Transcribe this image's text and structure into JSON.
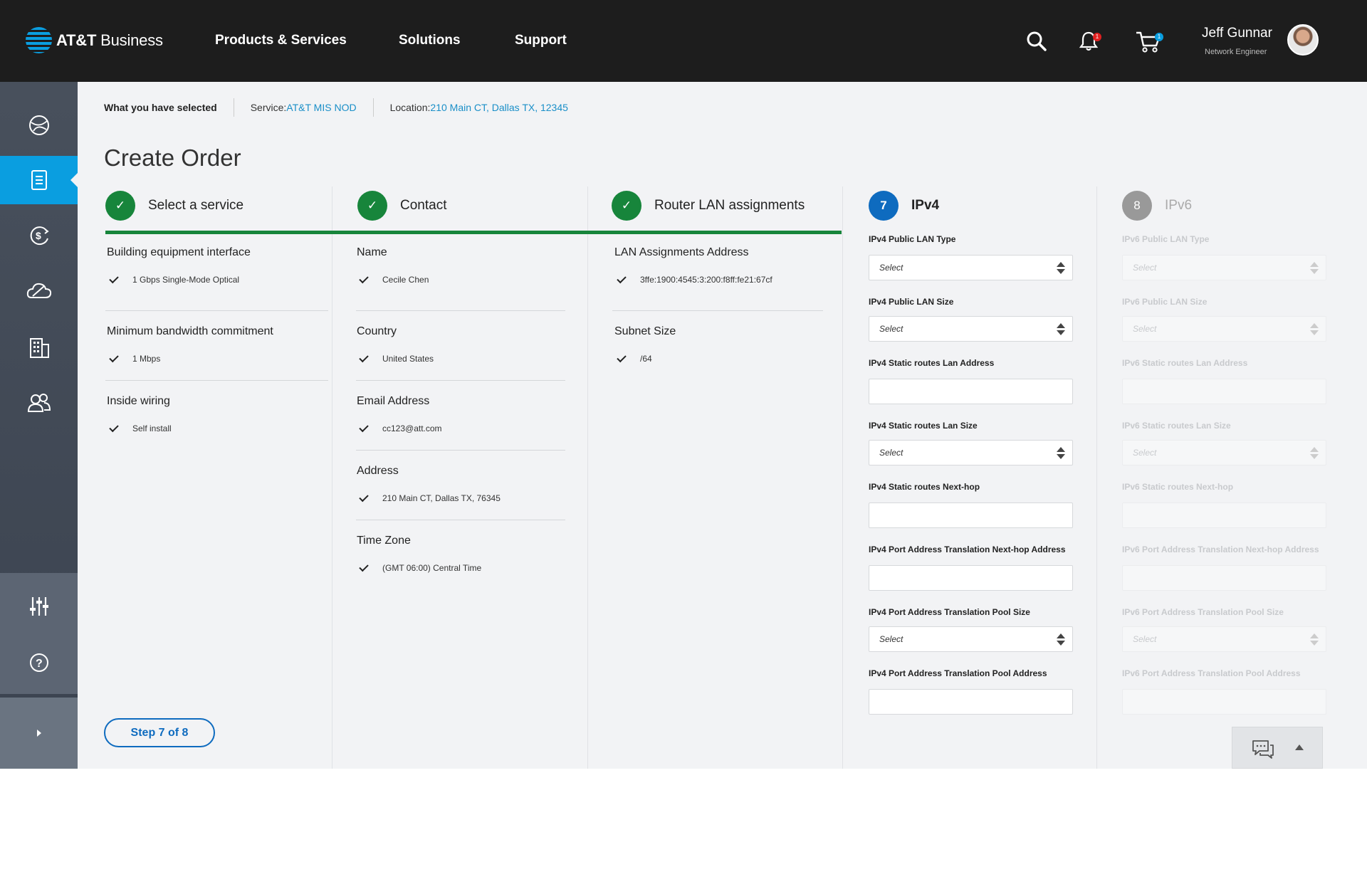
{
  "brand": {
    "name_bold": "AT&T",
    "name_rest": " Business"
  },
  "nav": {
    "items": [
      "Products & Services",
      "Solutions",
      "Support"
    ]
  },
  "header": {
    "notification_count": "1",
    "cart_count": "1"
  },
  "user": {
    "name": "Jeff Gunnar",
    "role": "Network Engineer"
  },
  "breadcrumb": {
    "title": "What you have selected",
    "service_label": "Service: ",
    "service_value": "AT&T MIS NOD",
    "location_label": "Location: ",
    "location_value": "210 Main CT, Dallas TX, 12345"
  },
  "page": {
    "title": "Create Order"
  },
  "steps": [
    {
      "label": "Select a service",
      "status": "done"
    },
    {
      "label": "Contact",
      "status": "done"
    },
    {
      "label": "Router LAN assignments",
      "status": "done"
    },
    {
      "number": "7",
      "label": "IPv4",
      "status": "current"
    },
    {
      "number": "8",
      "label": "IPv6",
      "status": "future"
    }
  ],
  "service": [
    {
      "label": "Building equipment interface",
      "value": "1 Gbps Single-Mode Optical"
    },
    {
      "label": "Minimum bandwidth commitment",
      "value": "1 Mbps"
    },
    {
      "label": "Inside wiring",
      "value": "Self install"
    }
  ],
  "contact": [
    {
      "label": "Name",
      "value": "Cecile Chen"
    },
    {
      "label": "Country",
      "value": "United States"
    },
    {
      "label": "Email Address",
      "value": "cc123@att.com"
    },
    {
      "label": "Address",
      "value": "210 Main CT, Dallas TX, 76345"
    },
    {
      "label": "Time Zone",
      "value": "(GMT 06:00) Central Time"
    }
  ],
  "router": [
    {
      "label": "LAN Assignments Address",
      "value": "3ffe:1900:4545:3:200:f8ff:fe21:67cf"
    },
    {
      "label": "Subnet Size",
      "value": "/64"
    }
  ],
  "ipv4": [
    {
      "label": "IPv4 Public LAN Type",
      "type": "select",
      "value": "Select"
    },
    {
      "label": "IPv4 Public LAN Size",
      "type": "select",
      "value": "Select"
    },
    {
      "label": "IPv4 Static routes Lan Address",
      "type": "text",
      "value": ""
    },
    {
      "label": "IPv4 Static routes Lan Size",
      "type": "select",
      "value": "Select"
    },
    {
      "label": "IPv4 Static routes Next-hop",
      "type": "text",
      "value": ""
    },
    {
      "label": "IPv4 Port Address Translation Next-hop Address",
      "type": "text",
      "value": ""
    },
    {
      "label": "IPv4 Port Address Translation Pool Size",
      "type": "select",
      "value": "Select"
    },
    {
      "label": "IPv4 Port Address Translation Pool Address",
      "type": "text",
      "value": ""
    }
  ],
  "ipv6": [
    {
      "label": "IPv6 Public LAN Type",
      "type": "select",
      "value": "Select"
    },
    {
      "label": "IPv6 Public LAN Size",
      "type": "select",
      "value": "Select"
    },
    {
      "label": "IPv6 Static routes Lan Address",
      "type": "text",
      "value": ""
    },
    {
      "label": "IPv6 Static routes Lan Size",
      "type": "select",
      "value": "Select"
    },
    {
      "label": "IPv6 Static routes Next-hop",
      "type": "text",
      "value": ""
    },
    {
      "label": "IPv6 Port Address Translation Next-hop Address",
      "type": "text",
      "value": ""
    },
    {
      "label": "IPv6 Port Address Translation Pool Size",
      "type": "select",
      "value": "Select"
    },
    {
      "label": "IPv6 Port Address Translation Pool Address",
      "type": "text",
      "value": ""
    }
  ],
  "footer": {
    "step_button": "Step 7 of 8"
  },
  "colors": {
    "brand_blue": "#0a9ee0",
    "done_green": "#17853b",
    "current_blue": "#0e6bbf",
    "topbar": "#1d1d1d"
  },
  "icons": [
    "globe-icon",
    "order-icon",
    "billing-icon",
    "cloud-icon",
    "building-icon",
    "users-icon",
    "settings-sliders-icon",
    "help-icon",
    "expand-icon",
    "search-icon",
    "bell-icon",
    "cart-icon",
    "chat-icon",
    "caret-up-icon"
  ]
}
